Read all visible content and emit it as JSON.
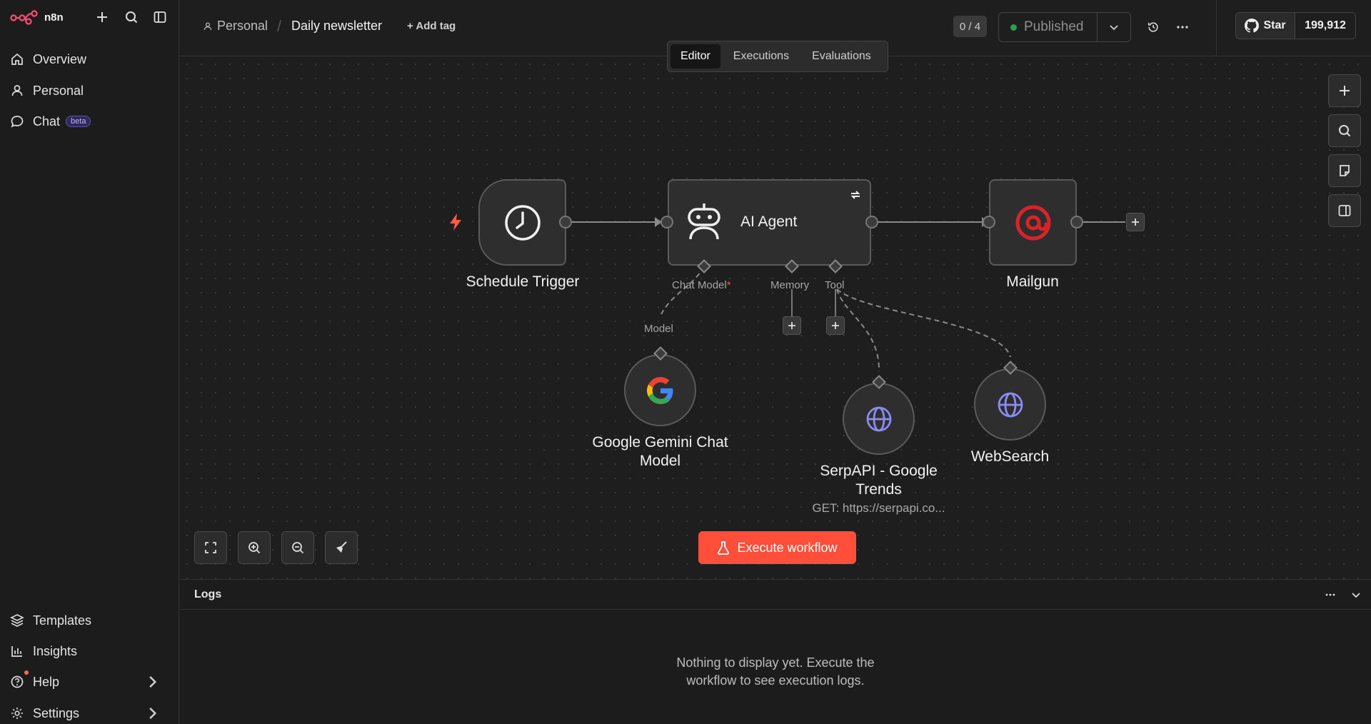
{
  "sidebar": {
    "brand": "n8n",
    "nav": [
      {
        "label": "Overview",
        "icon": "home-icon"
      },
      {
        "label": "Personal",
        "icon": "user-icon"
      },
      {
        "label": "Chat",
        "icon": "chat-icon",
        "badge": "beta"
      }
    ],
    "bottom": [
      {
        "label": "Templates",
        "icon": "templates-icon"
      },
      {
        "label": "Insights",
        "icon": "insights-icon"
      },
      {
        "label": "Help",
        "icon": "help-icon"
      },
      {
        "label": "Settings",
        "icon": "settings-icon"
      }
    ]
  },
  "header": {
    "project": "Personal",
    "workflow_name": "Daily newsletter",
    "add_tag": "+ Add tag",
    "counter": "0 / 4",
    "status": "Published",
    "github_star": "Star",
    "github_count": "199,912"
  },
  "tabs": [
    {
      "label": "Editor",
      "active": true
    },
    {
      "label": "Executions",
      "active": false
    },
    {
      "label": "Evaluations",
      "active": false
    }
  ],
  "nodes": {
    "schedule": {
      "label": "Schedule Trigger"
    },
    "agent": {
      "label": "AI Agent",
      "ports": {
        "chat_model": "Chat Model",
        "memory": "Memory",
        "tool": "Tool"
      }
    },
    "mailgun": {
      "label": "Mailgun"
    },
    "gemini": {
      "label_line1": "Google Gemini Chat",
      "label_line2": "Model",
      "port": "Model"
    },
    "serpapi": {
      "label_line1": "SerpAPI - Google",
      "label_line2": "Trends",
      "subtitle": "GET: https://serpapi.co..."
    },
    "websearch": {
      "label": "WebSearch"
    }
  },
  "canvas": {
    "execute_label": "Execute workflow"
  },
  "logs": {
    "title": "Logs",
    "empty_line1": "Nothing to display yet. Execute the",
    "empty_line2": "workflow to see execution logs."
  },
  "colors": {
    "accent": "#ff4f3a",
    "brand": "#ea4b71",
    "published_dot": "#2e9e4f",
    "mailgun": "#d8232a",
    "globe": "#8a8cf0"
  }
}
